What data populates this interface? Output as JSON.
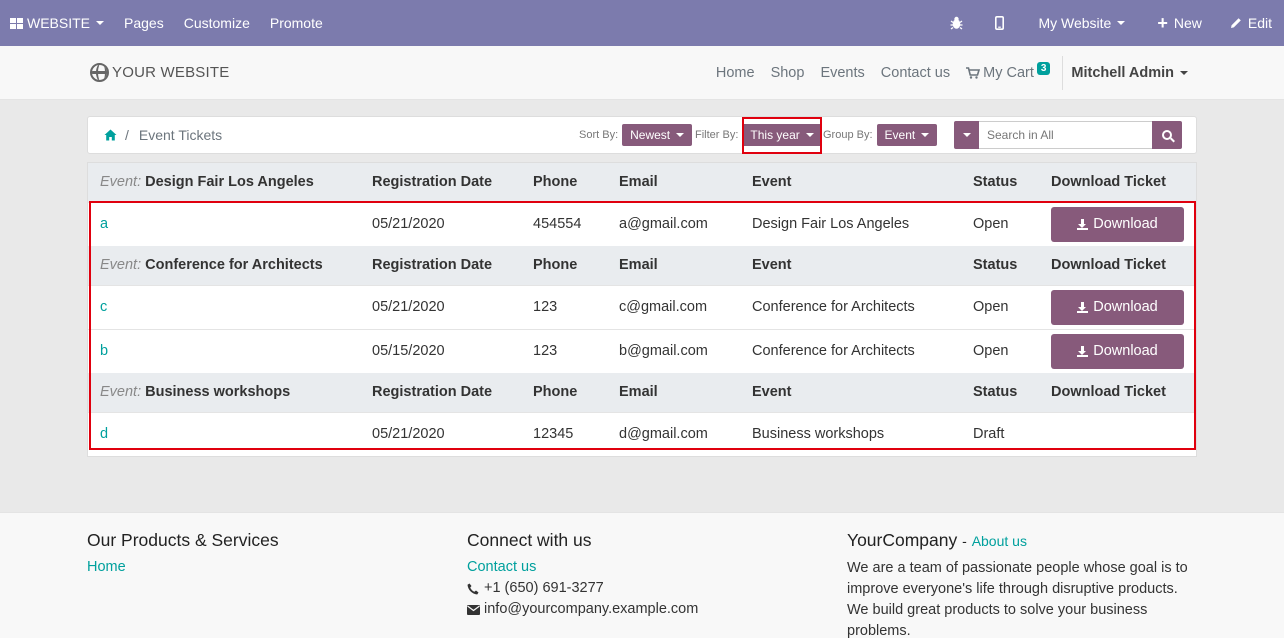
{
  "adminbar": {
    "website_label": "WEBSITE",
    "menu": [
      "Pages",
      "Customize",
      "Promote"
    ],
    "my_website_label": "My Website",
    "new_label": "New",
    "edit_label": "Edit"
  },
  "header": {
    "logo_text": "YOUR WEBSITE",
    "nav": [
      "Home",
      "Shop",
      "Events",
      "Contact us"
    ],
    "cart_label": "My Cart",
    "cart_count": "3",
    "user_name": "Mitchell Admin"
  },
  "toolbar": {
    "breadcrumb_page": "Event Tickets",
    "sort_label": "Sort By:",
    "sort_value": "Newest",
    "filter_label": "Filter By:",
    "filter_value": "This year",
    "group_label": "Group By:",
    "group_value": "Event",
    "search_placeholder": "Search in All"
  },
  "table": {
    "group_prefix": "Event:",
    "columns": [
      "Registration Date",
      "Phone",
      "Email",
      "Event",
      "Status",
      "Download Ticket"
    ],
    "download_label": "Download",
    "groups": [
      {
        "event": "Design Fair Los Angeles",
        "rows": [
          {
            "name": "a",
            "date": "05/21/2020",
            "phone": "454554",
            "email": "a@gmail.com",
            "event": "Design Fair Los Angeles",
            "status": "Open"
          }
        ]
      },
      {
        "event": "Conference for Architects",
        "rows": [
          {
            "name": "c",
            "date": "05/21/2020",
            "phone": "123",
            "email": "c@gmail.com",
            "event": "Conference for Architects",
            "status": "Open"
          },
          {
            "name": "b",
            "date": "05/15/2020",
            "phone": "123",
            "email": "b@gmail.com",
            "event": "Conference for Architects",
            "status": "Open"
          }
        ]
      },
      {
        "event": "Business workshops",
        "rows": [
          {
            "name": "d",
            "date": "05/21/2020",
            "phone": "12345",
            "email": "d@gmail.com",
            "event": "Business workshops",
            "status": "Draft"
          }
        ]
      }
    ]
  },
  "footer": {
    "col1_title": "Our Products & Services",
    "col1_link": "Home",
    "col2_title": "Connect with us",
    "col2_link": "Contact us",
    "phone": "+1 (650) 691-3277",
    "email": "info@yourcompany.example.com",
    "col3_title": "YourCompany",
    "col3_sep": "-",
    "col3_link": "About us",
    "col3_text": "We are a team of passionate people whose goal is to improve everyone's life through disruptive products. We build great products to solve your business problems."
  },
  "colors": {
    "adminbar_bg": "#7c7bad",
    "accent": "#875a7b",
    "link": "#00a09d",
    "highlight": "#e0000e"
  }
}
